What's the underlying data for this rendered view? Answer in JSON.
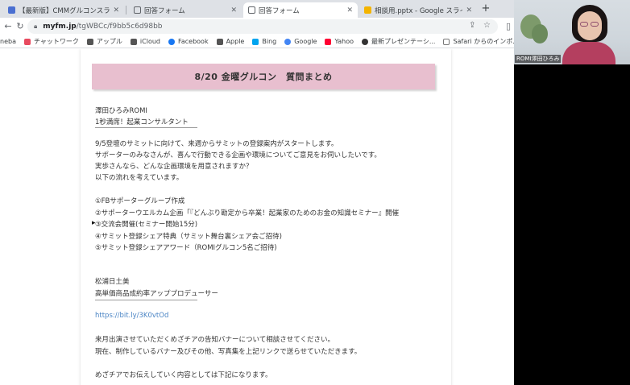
{
  "tabs": [
    {
      "title": "【最新版】CMMグルコンスライド",
      "active": false,
      "favicon_color": "#4a6fd1"
    },
    {
      "title": "回答フォーム",
      "active": false,
      "favicon_color": "#5f6368"
    },
    {
      "title": "回答フォーム",
      "active": true,
      "favicon_color": "#5f6368"
    },
    {
      "title": "相談用.pptx - Google スライド",
      "active": false,
      "favicon_color": "#f4b400"
    }
  ],
  "new_tab_label": "+",
  "address": {
    "host": "myfm.jp",
    "path": "/tgWBCc/f9bb5c6d98bb"
  },
  "bookmarks": [
    {
      "label": "neba",
      "icon_color": ""
    },
    {
      "label": "チャットワーク",
      "icon_color": "#e84a5f"
    },
    {
      "label": "アップル",
      "icon_color": "#555555"
    },
    {
      "label": "iCloud",
      "icon_color": "#555555"
    },
    {
      "label": "Facebook",
      "icon_color": "#1877f2"
    },
    {
      "label": "Apple",
      "icon_color": "#555555"
    },
    {
      "label": "Bing",
      "icon_color": "#00a4ef"
    },
    {
      "label": "Google",
      "icon_color": "#4285f4"
    },
    {
      "label": "Yahoo",
      "icon_color": "#ff0033"
    },
    {
      "label": "最新プレゼンテーシ...",
      "icon_color": "#333333"
    },
    {
      "label": "Safari からのインポ...",
      "icon_color": "#777777"
    }
  ],
  "doc": {
    "banner": "8/20 金曜グルコン　質問まとめ",
    "blocks": [
      {
        "kind": "text",
        "text": "澤田ひろみROMI"
      },
      {
        "kind": "text",
        "text": "1秒満席！起業コンサルタント"
      },
      {
        "kind": "rule"
      },
      {
        "kind": "text",
        "text": "9/5登壇のサミットに向けて、来週からサミットの登録案内がスタートします。"
      },
      {
        "kind": "text",
        "text": "サポーターのみなさんが、喜んで行動できる企画や環境についてご意見をお伺いしたいです。"
      },
      {
        "kind": "text",
        "text": "実歩さんなら、どんな企画環境を用意されますか？"
      },
      {
        "kind": "text",
        "text": "以下の流れを考えています。"
      },
      {
        "kind": "text",
        "text": "①FBサポーターグループ作成"
      },
      {
        "kind": "text",
        "text": "②サポーターウエルカム企画「『どんぶり勘定から卒業！起業家のためのお金の知識セミナー』開催"
      },
      {
        "kind": "text",
        "text": "③交流会開催(セミナー開始15分)"
      },
      {
        "kind": "text",
        "text": "④サミット登録シェア特典（サミット舞台裏シェア会ご招待)"
      },
      {
        "kind": "text",
        "text": "⑤サミット登録シェアアワード（ROMIグルコン5名ご招待)"
      },
      {
        "kind": "text",
        "text": "松浦日土美"
      },
      {
        "kind": "text",
        "text": "高単価商品成約率アッププロデューサー"
      },
      {
        "kind": "rule"
      },
      {
        "kind": "link",
        "text": "https://bit.ly/3K0vtOd"
      },
      {
        "kind": "text",
        "text": "来月出演させていただくめざチアの告知バナーについて相談させてください。"
      },
      {
        "kind": "text",
        "text": "現在、制作しているバナー及びその他、写真集を上記リンクで送らせていただきます。"
      },
      {
        "kind": "text",
        "text": "めざチアでお伝えしていく内容としては下記になります。"
      }
    ]
  },
  "video": {
    "name_label": "ROMI澤田ひろみ"
  }
}
